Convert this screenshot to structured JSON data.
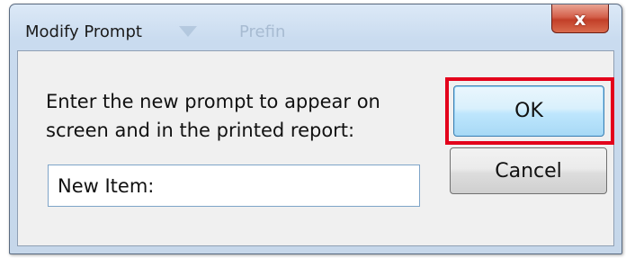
{
  "window": {
    "title": "Modify Prompt",
    "background_title_text": "Prefin",
    "close_glyph": "x"
  },
  "dialog": {
    "message_line_1": "Enter the new prompt to appear on",
    "message_line_2": "screen and in the printed report:",
    "prompt_input_value": "New Item:"
  },
  "buttons": {
    "ok_label": "OK",
    "cancel_label": "Cancel"
  },
  "colors": {
    "highlight": "#e3001b",
    "close_button": "#c23f28",
    "ok_button_border": "#3c7fb1"
  }
}
